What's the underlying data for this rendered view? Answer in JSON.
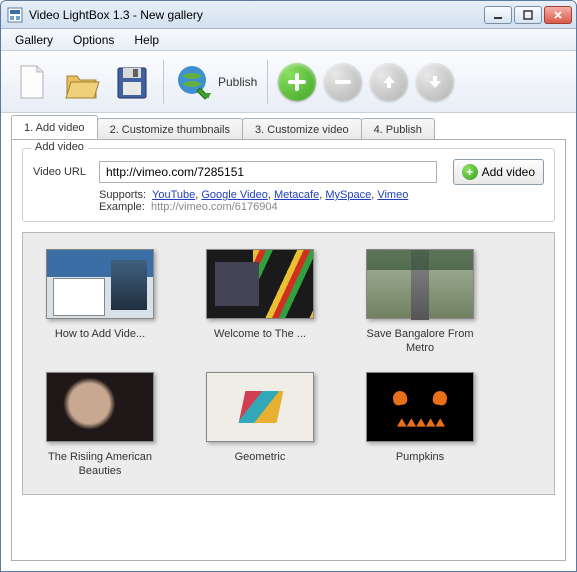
{
  "window": {
    "title": "Video LightBox 1.3  - New gallery"
  },
  "menubar": {
    "items": [
      "Gallery",
      "Options",
      "Help"
    ]
  },
  "toolbar": {
    "publish_label": "Publish"
  },
  "tabs": [
    {
      "label": "1. Add video",
      "active": true
    },
    {
      "label": "2. Customize thumbnails",
      "active": false
    },
    {
      "label": "3. Customize video",
      "active": false
    },
    {
      "label": "4. Publish",
      "active": false
    }
  ],
  "addvideo": {
    "legend": "Add video",
    "url_label": "Video URL",
    "url_value": "http://vimeo.com/7285151",
    "supports_label": "Supports:",
    "supports_links": [
      "YouTube",
      "Google Video",
      "Metacafe",
      "MySpace",
      "Vimeo"
    ],
    "example_label": "Example:",
    "example_value": "http://vimeo.com/6176904",
    "add_button": "Add video"
  },
  "gallery": {
    "items": [
      {
        "label": "How to Add Vide..."
      },
      {
        "label": "Welcome to The ..."
      },
      {
        "label": "Save Bangalore From Metro"
      },
      {
        "label": "The Risiing American Beauties"
      },
      {
        "label": "Geometric"
      },
      {
        "label": "Pumpkins"
      }
    ]
  }
}
